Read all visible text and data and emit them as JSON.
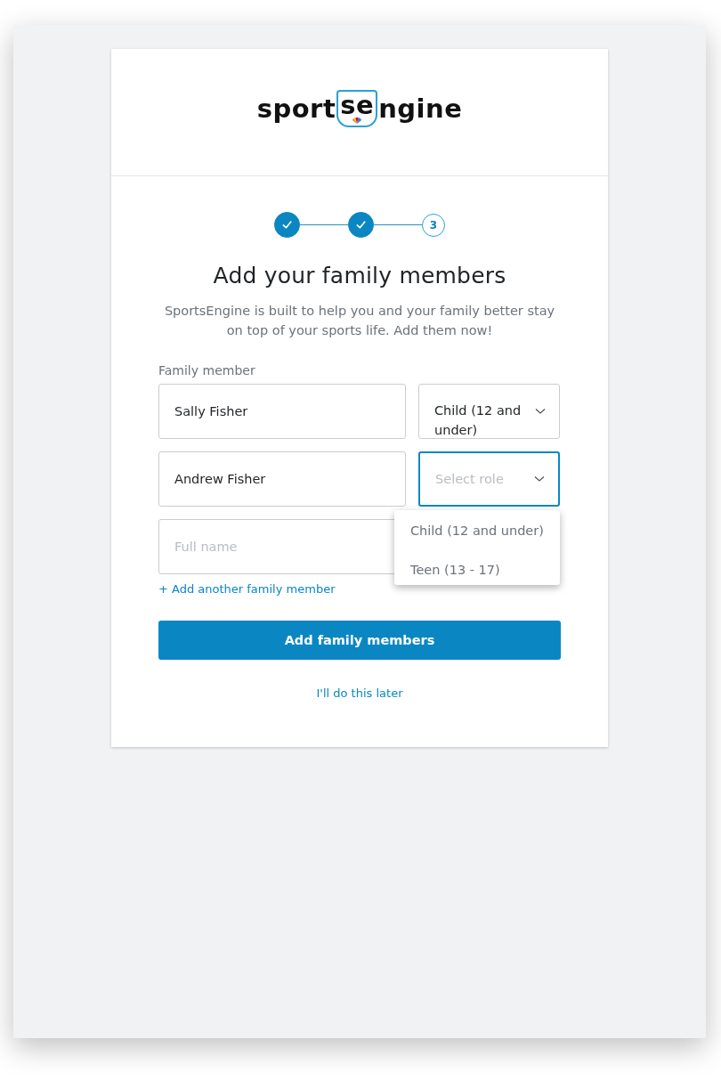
{
  "logo": {
    "parts": [
      "sport",
      "se",
      "ngine"
    ]
  },
  "steps": [
    {
      "done": true
    },
    {
      "done": true
    },
    {
      "done": false,
      "label": "3"
    }
  ],
  "title": "Add your family members",
  "subtitle": "SportsEngine is built to help you and your family better stay on top of your sports life. Add them now!",
  "field_label": "Family member",
  "members": [
    {
      "name": "Sally Fisher",
      "role": {
        "value": "Child (12 and under)",
        "focused": false
      }
    },
    {
      "name": "Andrew Fisher",
      "role": {
        "placeholder": "Select role",
        "focused": true,
        "expanded": true,
        "options": [
          "Child (12 and under)",
          "Teen (13 - 17)"
        ]
      }
    },
    {
      "placeholder": "Full name"
    }
  ],
  "add_link": "+ Add another family member",
  "submit": "Add family members",
  "later_link": "I'll do this later"
}
